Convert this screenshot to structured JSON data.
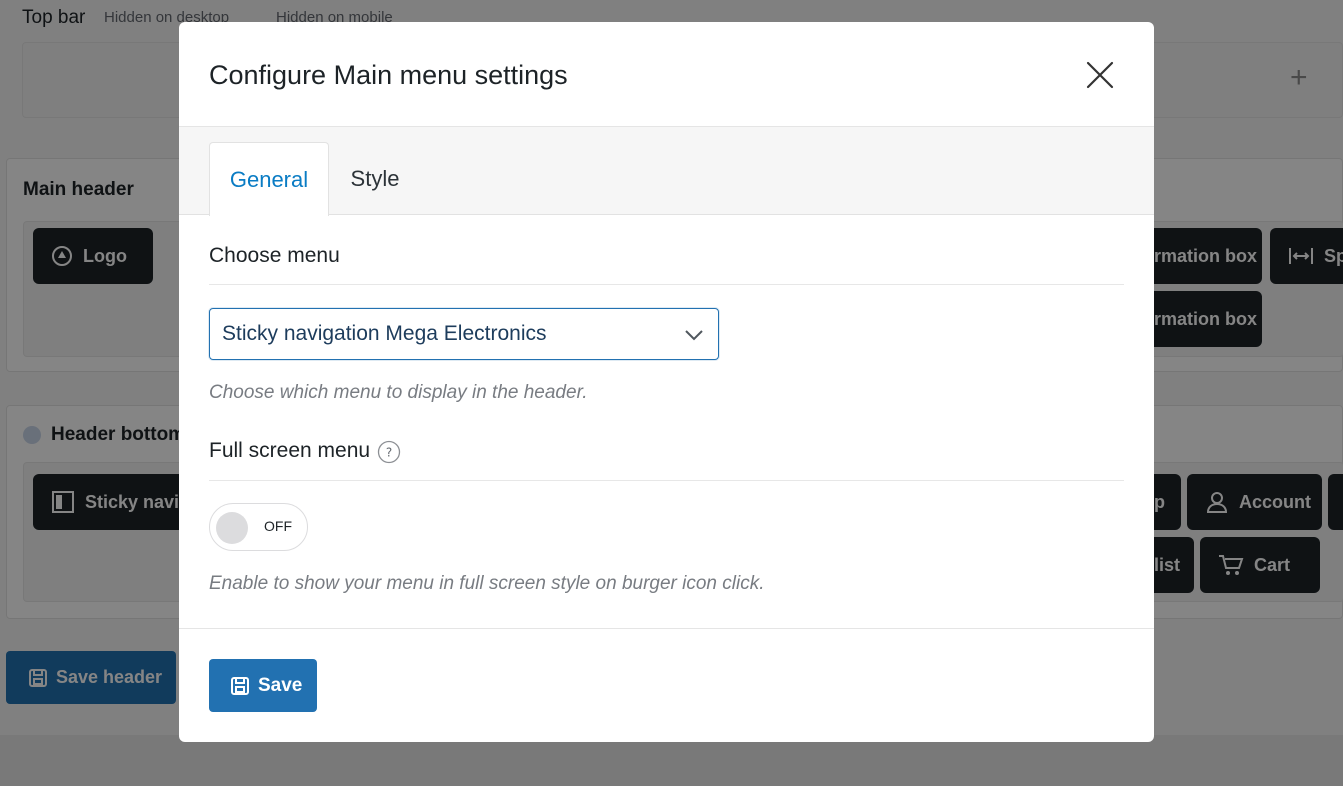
{
  "background": {
    "top_bar": {
      "title": "Top bar",
      "hidden_desktop": "Hidden on desktop",
      "hidden_mobile": "Hidden on mobile"
    },
    "main_header": {
      "title": "Main header",
      "chips": [
        "Logo",
        "rmation box",
        "Sp",
        "rmation box"
      ]
    },
    "header_bottom": {
      "title": "Header bottom",
      "chips": [
        "Sticky navig",
        "p",
        "Account",
        "list",
        "Cart"
      ]
    },
    "save_header_label": "Save header"
  },
  "modal": {
    "title": "Configure Main menu settings",
    "tabs": [
      {
        "label": "General",
        "active": true
      },
      {
        "label": "Style",
        "active": false
      }
    ],
    "choose_menu": {
      "label": "Choose menu",
      "selected": "Sticky navigation Mega Electronics",
      "help": "Choose which menu to display in the header."
    },
    "full_screen_menu": {
      "label": "Full screen menu",
      "toggle_state": "OFF",
      "help": "Enable to show your menu in full screen style on burger icon click."
    },
    "save_label": "Save"
  },
  "colors": {
    "accent": "#2271b1",
    "tab_active_text": "#0a7cc4",
    "chip_bg": "#1d2327"
  }
}
